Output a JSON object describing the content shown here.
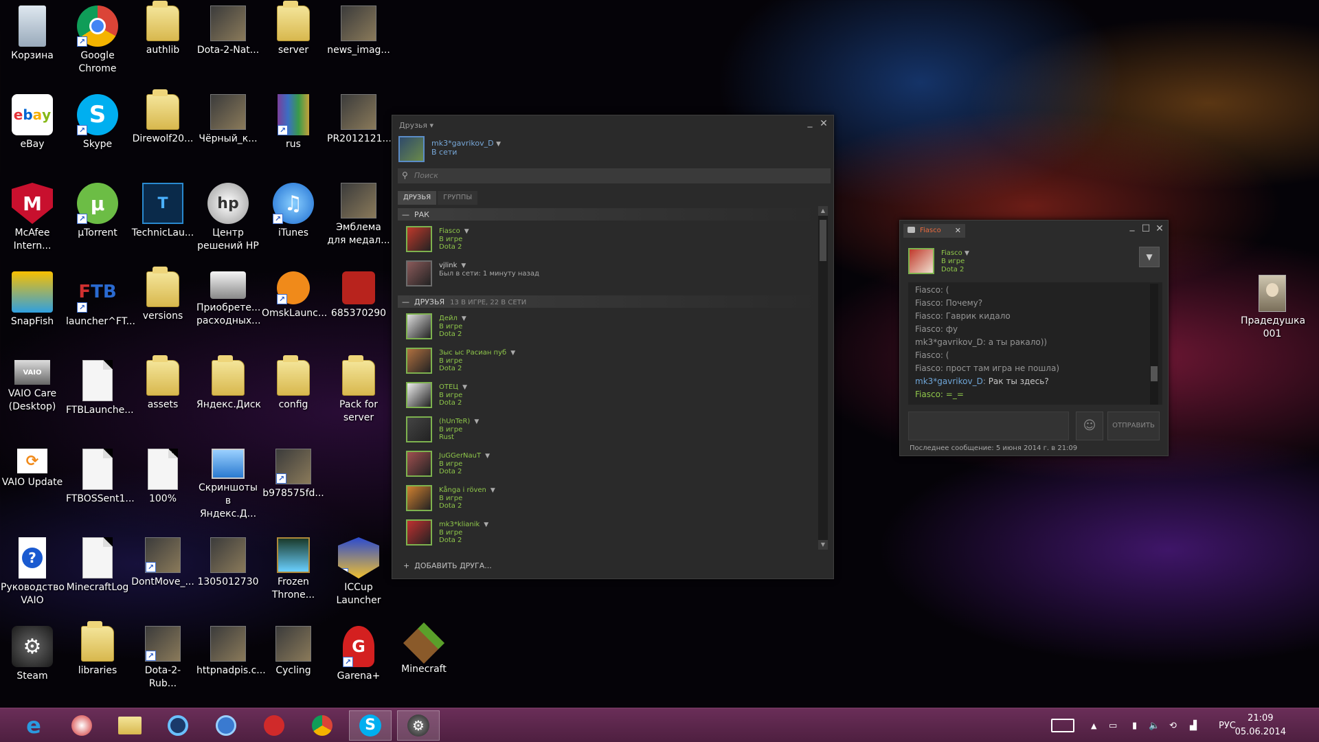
{
  "desktop": {
    "icons": [
      {
        "label": "Корзина",
        "icon": "recycle-bin-icon",
        "col": 0,
        "row": 0
      },
      {
        "label": "Google Chrome",
        "icon": "chrome-icon",
        "col": 1,
        "row": 0
      },
      {
        "label": "authlib",
        "icon": "folder-icon",
        "col": 2,
        "row": 0
      },
      {
        "label": "Dota-2-Nat...",
        "icon": "image-icon",
        "col": 3,
        "row": 0
      },
      {
        "label": "server",
        "icon": "folder-icon",
        "col": 4,
        "row": 0
      },
      {
        "label": "news_imag...",
        "icon": "image-icon",
        "col": 5,
        "row": 0
      },
      {
        "label": "eBay",
        "icon": "ebay-icon",
        "col": 0,
        "row": 1
      },
      {
        "label": "Skype",
        "icon": "skype-icon",
        "col": 1,
        "row": 1
      },
      {
        "label": "Direwolf20...",
        "icon": "folder-icon",
        "col": 2,
        "row": 1
      },
      {
        "label": "Чёрный_к...",
        "icon": "image-icon",
        "col": 3,
        "row": 1
      },
      {
        "label": "rus",
        "icon": "winrar-icon",
        "col": 4,
        "row": 1
      },
      {
        "label": "PR2012121...",
        "icon": "image-icon",
        "col": 5,
        "row": 1
      },
      {
        "label": "McAfee Intern...",
        "icon": "mcafee-icon",
        "col": 0,
        "row": 2
      },
      {
        "label": "µTorrent",
        "icon": "utorrent-icon",
        "col": 1,
        "row": 2
      },
      {
        "label": "TechnicLau...",
        "icon": "technic-icon",
        "col": 2,
        "row": 2
      },
      {
        "label": "Центр решений HP",
        "icon": "hp-icon",
        "col": 3,
        "row": 2
      },
      {
        "label": "iTunes",
        "icon": "itunes-icon",
        "col": 4,
        "row": 2
      },
      {
        "label": "Эмблема для медал...",
        "icon": "image-icon",
        "col": 5,
        "row": 2
      },
      {
        "label": "SnapFish",
        "icon": "snapfish-icon",
        "col": 0,
        "row": 3
      },
      {
        "label": "launcher^FT...",
        "icon": "ftb-icon",
        "col": 1,
        "row": 3
      },
      {
        "label": "versions",
        "icon": "folder-icon",
        "col": 2,
        "row": 3
      },
      {
        "label": "Приобрете... расходных...",
        "icon": "printer-icon",
        "col": 3,
        "row": 3
      },
      {
        "label": "OmskLaunc...",
        "icon": "omsk-icon",
        "col": 4,
        "row": 3
      },
      {
        "label": "685370290",
        "icon": "dota-icon",
        "col": 5,
        "row": 3
      },
      {
        "label": "VAIO Care (Desktop)",
        "icon": "vaio-icon",
        "col": 0,
        "row": 4
      },
      {
        "label": "FTBLaunche...",
        "icon": "file-icon",
        "col": 1,
        "row": 4
      },
      {
        "label": "assets",
        "icon": "folder-icon",
        "col": 2,
        "row": 4
      },
      {
        "label": "Яндекс.Диск",
        "icon": "folder-icon",
        "col": 3,
        "row": 4
      },
      {
        "label": "config",
        "icon": "folder-icon",
        "col": 4,
        "row": 4
      },
      {
        "label": "Pack for server",
        "icon": "folder-icon",
        "col": 5,
        "row": 4
      },
      {
        "label": "VAIO Update",
        "icon": "vaio-update-icon",
        "col": 0,
        "row": 5
      },
      {
        "label": "FTBOSSent1...",
        "icon": "file-icon",
        "col": 1,
        "row": 5
      },
      {
        "label": "100%",
        "icon": "file-icon",
        "col": 2,
        "row": 5
      },
      {
        "label": "Скриншоты в Яндекс.Д...",
        "icon": "screenshot-icon",
        "col": 3,
        "row": 5
      },
      {
        "label": "b978575fd...",
        "icon": "image-icon",
        "col": 4,
        "row": 5
      },
      {
        "label": "Руководство VAIO",
        "icon": "help-icon",
        "col": 0,
        "row": 6
      },
      {
        "label": "MinecraftLog",
        "icon": "file-icon",
        "col": 1,
        "row": 6
      },
      {
        "label": "DontMove_...",
        "icon": "image-icon",
        "col": 2,
        "row": 6
      },
      {
        "label": "1305012730",
        "icon": "image-icon",
        "col": 3,
        "row": 6
      },
      {
        "label": "Frozen Throne...",
        "icon": "warcraft-icon",
        "col": 4,
        "row": 6
      },
      {
        "label": "ICCup Launcher",
        "icon": "iccup-icon",
        "col": 5,
        "row": 6
      },
      {
        "label": "Steam",
        "icon": "steam-icon",
        "col": 0,
        "row": 7
      },
      {
        "label": "libraries",
        "icon": "folder-icon",
        "col": 1,
        "row": 7
      },
      {
        "label": "Dota-2-Rub...",
        "icon": "image-icon",
        "col": 2,
        "row": 7
      },
      {
        "label": "httpnadpis.c...",
        "icon": "image-icon",
        "col": 3,
        "row": 7
      },
      {
        "label": "Cycling",
        "icon": "image-icon",
        "col": 4,
        "row": 7
      },
      {
        "label": "Garena+",
        "icon": "garena-icon",
        "col": 5,
        "row": 7
      },
      {
        "label": "Minecraft",
        "icon": "minecraft-icon",
        "col": 6,
        "row": 7
      }
    ],
    "right_icon": {
      "label": "Прадедушка 001",
      "icon": "portrait-icon"
    }
  },
  "friends_window": {
    "title": "Друзья ▾",
    "self_name": "mk3*gavrikov_D",
    "self_status": "В сети",
    "search_placeholder": "Поиск",
    "tabs": [
      "ДРУЗЬЯ",
      "ГРУППЫ"
    ],
    "groups": [
      {
        "name": "РАК",
        "meta": "",
        "friends": [
          {
            "name": "Fiasco",
            "status": "В игре",
            "game": "Dota 2",
            "offline": false,
            "color": "#c0392b"
          },
          {
            "name": "vjlink",
            "status": "Был в сети: 1 минуту назад",
            "game": "",
            "offline": true,
            "color": "#8a5a5a"
          }
        ]
      },
      {
        "name": "ДРУЗЬЯ",
        "meta": "13 В ИГРЕ, 22 В СЕТИ",
        "friends": [
          {
            "name": "Дейл",
            "status": "В игре",
            "game": "Dota 2",
            "offline": false,
            "color": "#ddd"
          },
          {
            "name": "Зыс ыс Расиан пуб",
            "status": "В игре",
            "game": "Dota 2",
            "offline": false,
            "color": "#b07040"
          },
          {
            "name": "ОТЕЦ",
            "status": "В игре",
            "game": "Dota 2",
            "offline": false,
            "color": "#eee"
          },
          {
            "name": "(hUnTeR)",
            "status": "В игре",
            "game": "Rust",
            "offline": false,
            "color": "#444"
          },
          {
            "name": "JuGGerNauT",
            "status": "В игре",
            "game": "Dota 2",
            "offline": false,
            "color": "#a05050"
          },
          {
            "name": "Kånga i röven",
            "status": "В игре",
            "game": "Dota 2",
            "offline": false,
            "color": "#d08030"
          },
          {
            "name": "mk3*klianik",
            "status": "В игре",
            "game": "Dota 2",
            "offline": false,
            "color": "#c03030"
          }
        ]
      }
    ],
    "add_friend": "ДОБАВИТЬ ДРУГА..."
  },
  "chat_window": {
    "tab_label": "Fiasco",
    "user_name": "Fiasco",
    "user_status": "В игре",
    "user_game": "Dota 2",
    "messages": [
      {
        "who": "Fiasco",
        "text": "(",
        "self": false
      },
      {
        "who": "Fiasco",
        "text": "Почему?",
        "self": false
      },
      {
        "who": "Fiasco",
        "text": "Гаврик кидало",
        "self": false
      },
      {
        "who": "Fiasco",
        "text": "фу",
        "self": false
      },
      {
        "who": "mk3*gavrikov_D",
        "text": "а ты ракало))",
        "self": false
      },
      {
        "who": "Fiasco",
        "text": "(",
        "self": false
      },
      {
        "who": "Fiasco",
        "text": "прост там игра не пошла)",
        "self": false
      },
      {
        "who": "mk3*gavrikov_D",
        "text": "Рак ты здесь?",
        "self": true
      },
      {
        "who": "Fiasco",
        "text": "=_=",
        "self": false,
        "last": true
      }
    ],
    "send_label": "ОТПРАВИТЬ",
    "last_message": "Последнее сообщение: 5 июня 2014 г. в 21:09"
  },
  "taskbar": {
    "apps": [
      "ie-icon",
      "ball-icon",
      "explorer-icon",
      "media-icon",
      "film-icon",
      "audio-icon",
      "chrome-icon",
      "skype-icon",
      "steam-icon"
    ],
    "lang": "РУС",
    "time": "21:09",
    "date": "05.06.2014"
  }
}
